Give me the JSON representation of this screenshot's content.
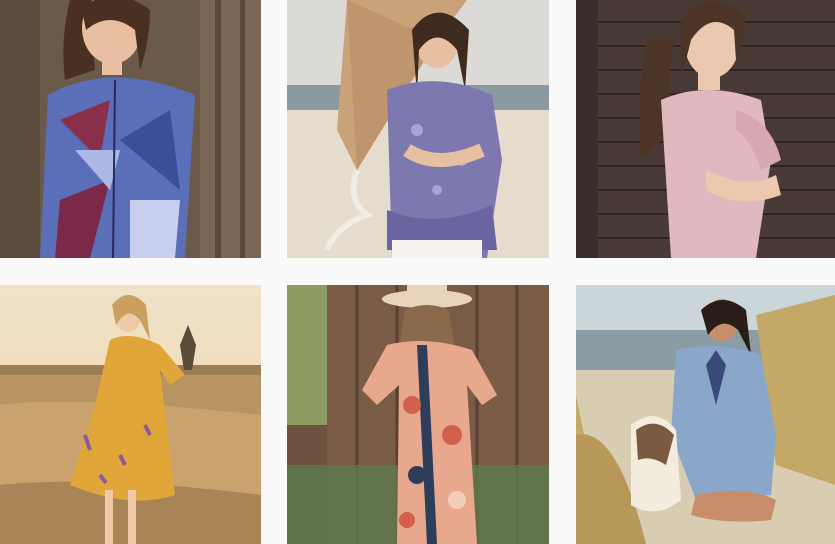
{
  "feed": {
    "posts": [
      {
        "subject": "woman-in-patchwork-blouse",
        "palette": {
          "bg": "#6b5a4a",
          "garment": "#5a6fb8",
          "accent": "#8a2f4a",
          "skin": "#e8bfa0",
          "hair": "#4a3020"
        }
      },
      {
        "subject": "woman-on-beach-with-kite",
        "palette": {
          "bg": "#d8d4cc",
          "garment": "#7e78b0",
          "accent": "#c9a27a",
          "skin": "#e6c0a0",
          "hair": "#3e2a1e"
        }
      },
      {
        "subject": "woman-in-pink-top-brick-wall",
        "palette": {
          "bg": "#4a3a36",
          "garment": "#e2b8c0",
          "accent": "#3a2e2c",
          "skin": "#ecc8ae",
          "hair": "#4c3426"
        }
      },
      {
        "subject": "woman-in-yellow-dress-field",
        "palette": {
          "bg": "#c9a26e",
          "garment": "#e0a63a",
          "accent": "#e9d6b4",
          "skin": "#efcaa8",
          "hair": "#c9a060"
        }
      },
      {
        "subject": "woman-in-floral-dress-hat",
        "palette": {
          "bg": "#6e5240",
          "garment": "#e8a88e",
          "accent": "#2d3e5a",
          "skin": "#e8c2a4",
          "hair": "#8a6a4a"
        }
      },
      {
        "subject": "woman-in-blue-tunic-dunes",
        "palette": {
          "bg": "#b8c8cf",
          "garment": "#8aa6c8",
          "accent": "#c4a868",
          "skin": "#c88e6a",
          "hair": "#2a1c16"
        }
      }
    ]
  }
}
